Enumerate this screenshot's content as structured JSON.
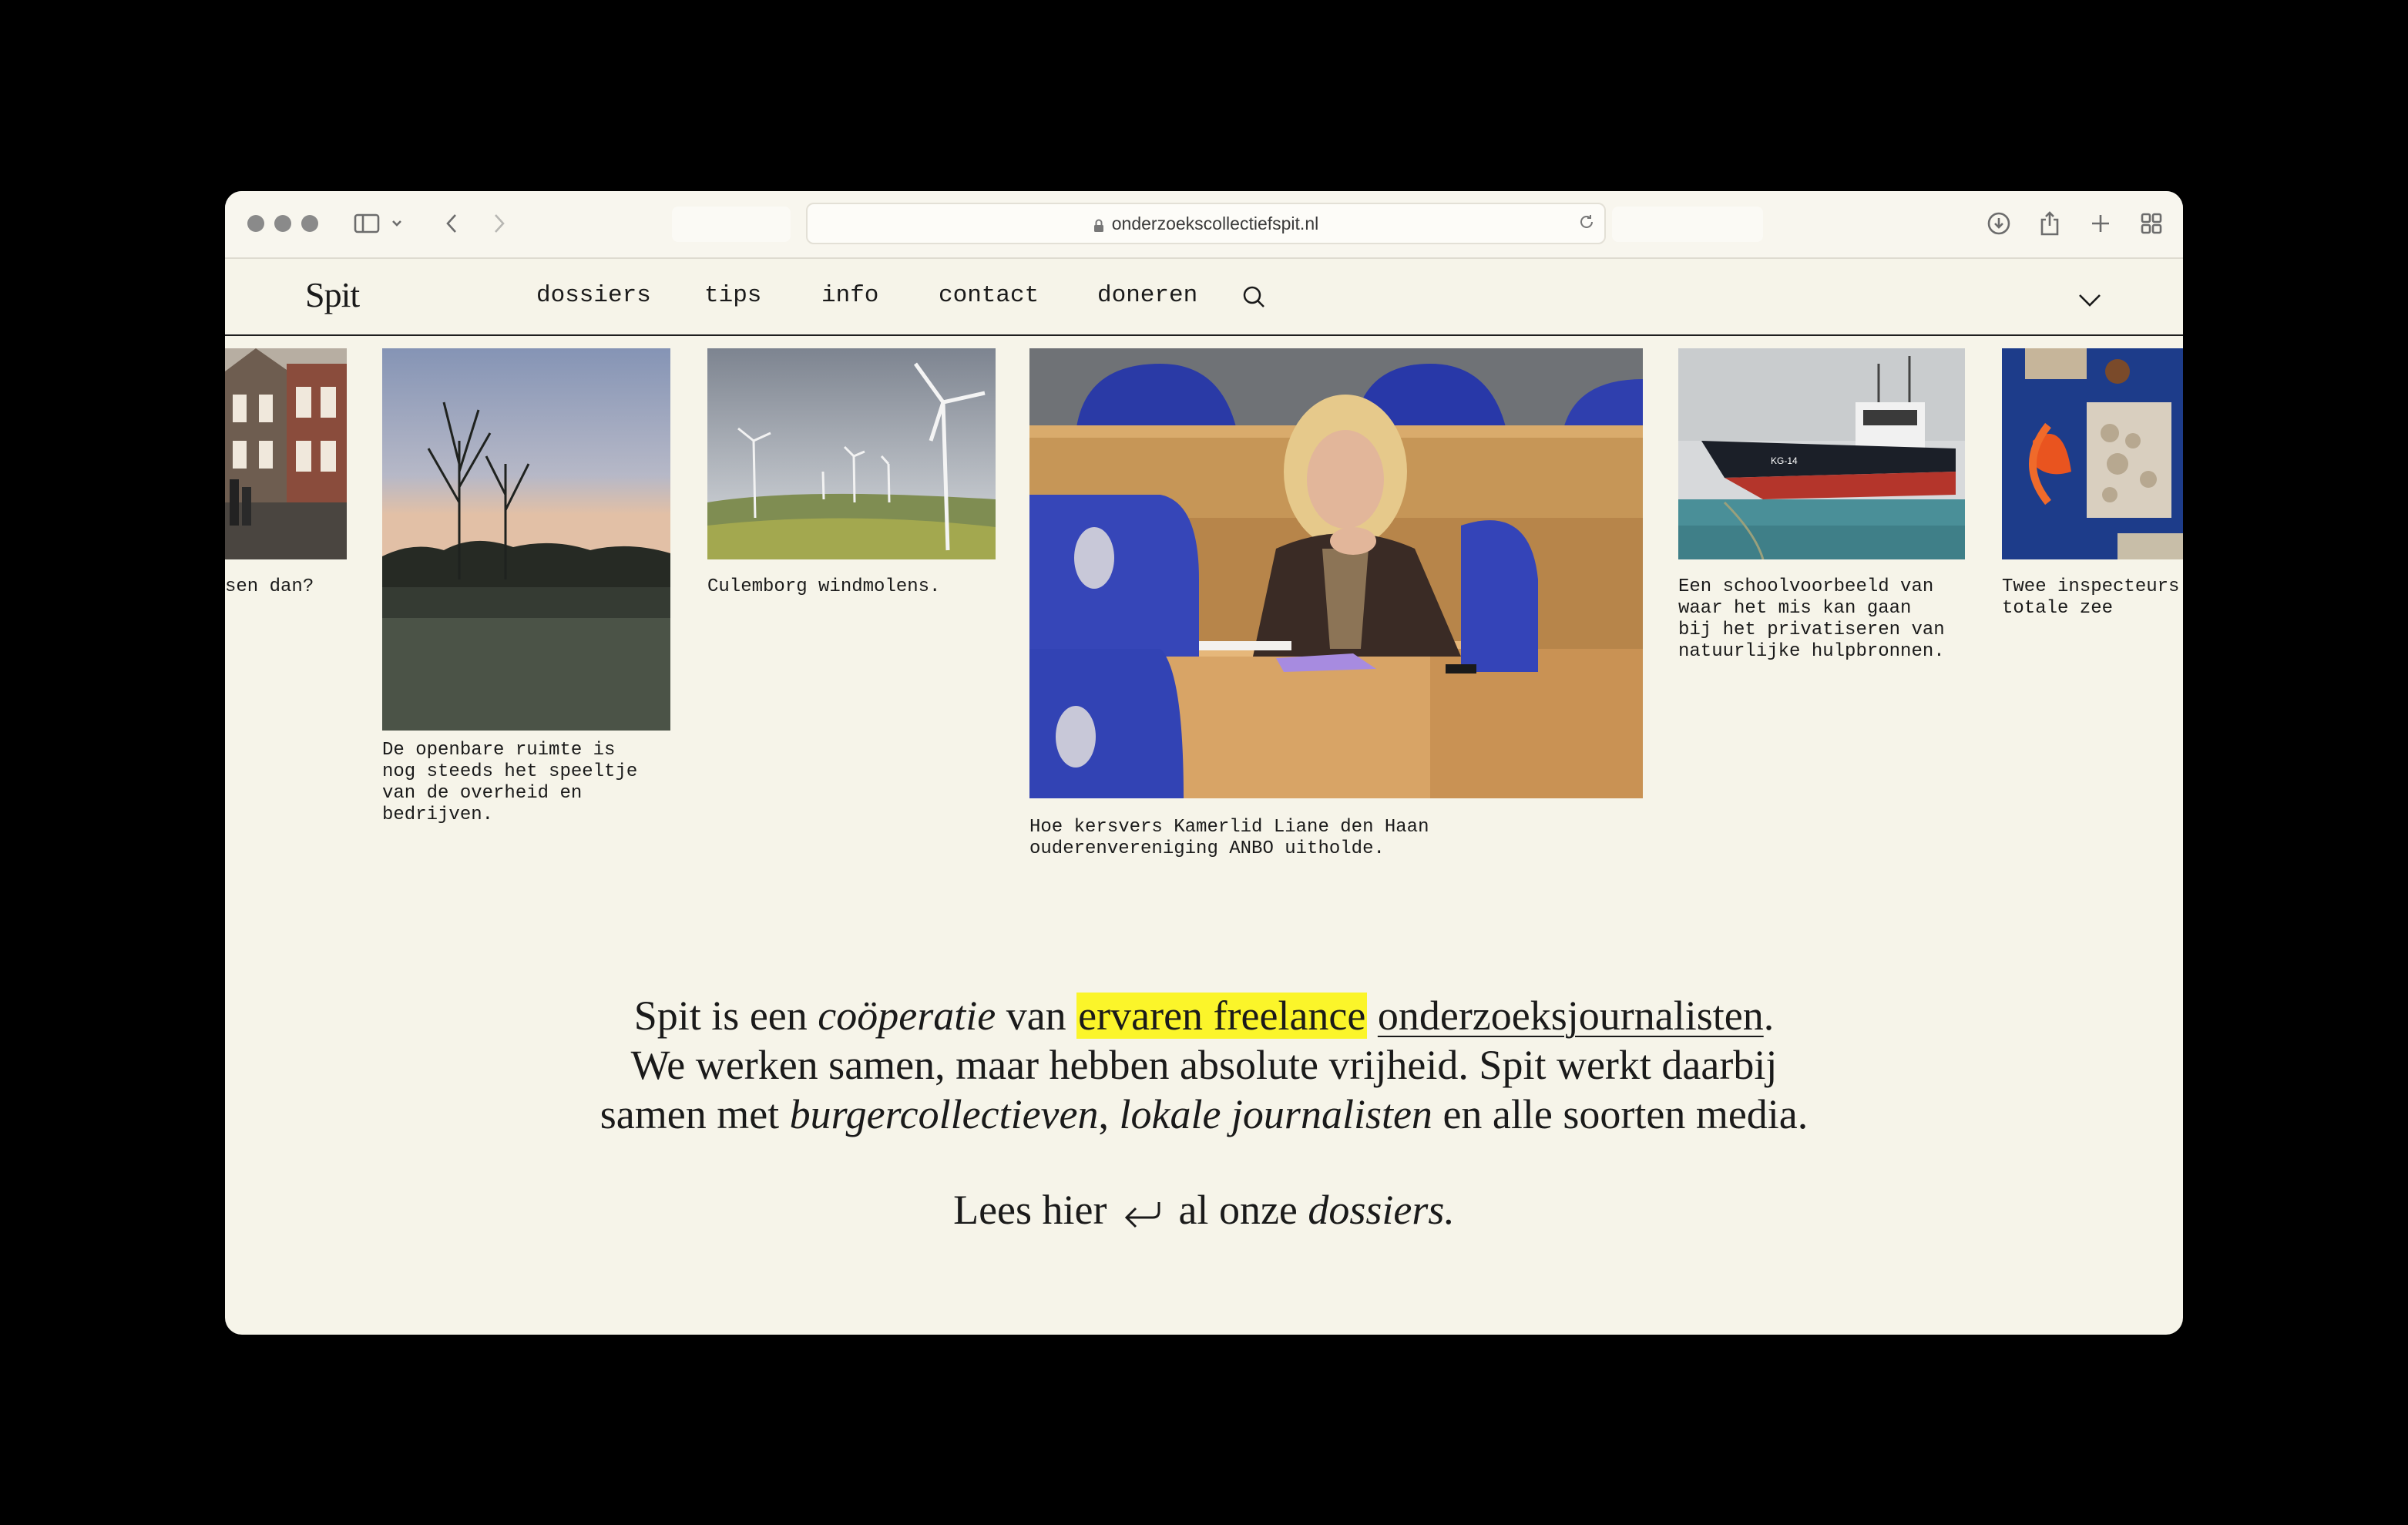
{
  "browser": {
    "url": "onderzoekscollectiefspit.nl"
  },
  "site": {
    "logo": "Spit",
    "nav": [
      "dossiers",
      "tips",
      "info",
      "contact",
      "doneren"
    ]
  },
  "carousel": [
    {
      "caption": "sen dan?"
    },
    {
      "caption": "De openbare ruimte is\nnog steeds het speeltje\nvan de overheid en\nbedrijven."
    },
    {
      "caption": "Culemborg windmolens."
    },
    {
      "caption": "Hoe kersvers Kamerlid Liane den Haan\nouderenvereniging ANBO uitholde."
    },
    {
      "caption": "Een schoolvoorbeeld van\nwaar het mis kan gaan\nbij het privatiseren van\nnatuurlijke hulpbronnen."
    },
    {
      "caption": "Twee inspecteurs\ntotale zee"
    }
  ],
  "intro": {
    "p1": "Spit is een ",
    "p1_em": "coöperatie",
    "p2": " van ",
    "highlight": "ervaren freelance",
    "p3": " ",
    "link": "onderzoeksjournalisten",
    "p4": ".",
    "line2": "We werken samen, maar hebben absolute vrijheid. Spit werkt daarbij",
    "l3a": "samen met ",
    "l3_em1": "burgercollectieven",
    "l3b": ", ",
    "l3_em2": "lokale journalisten",
    "l3c": " en alle soorten media."
  },
  "cta": {
    "before": "Lees hier",
    "after": " al onze ",
    "em": "dossiers."
  },
  "colors": {
    "page_bg": "#f6f4e9",
    "highlight": "#fbf52a",
    "text": "#1a1a1a"
  }
}
